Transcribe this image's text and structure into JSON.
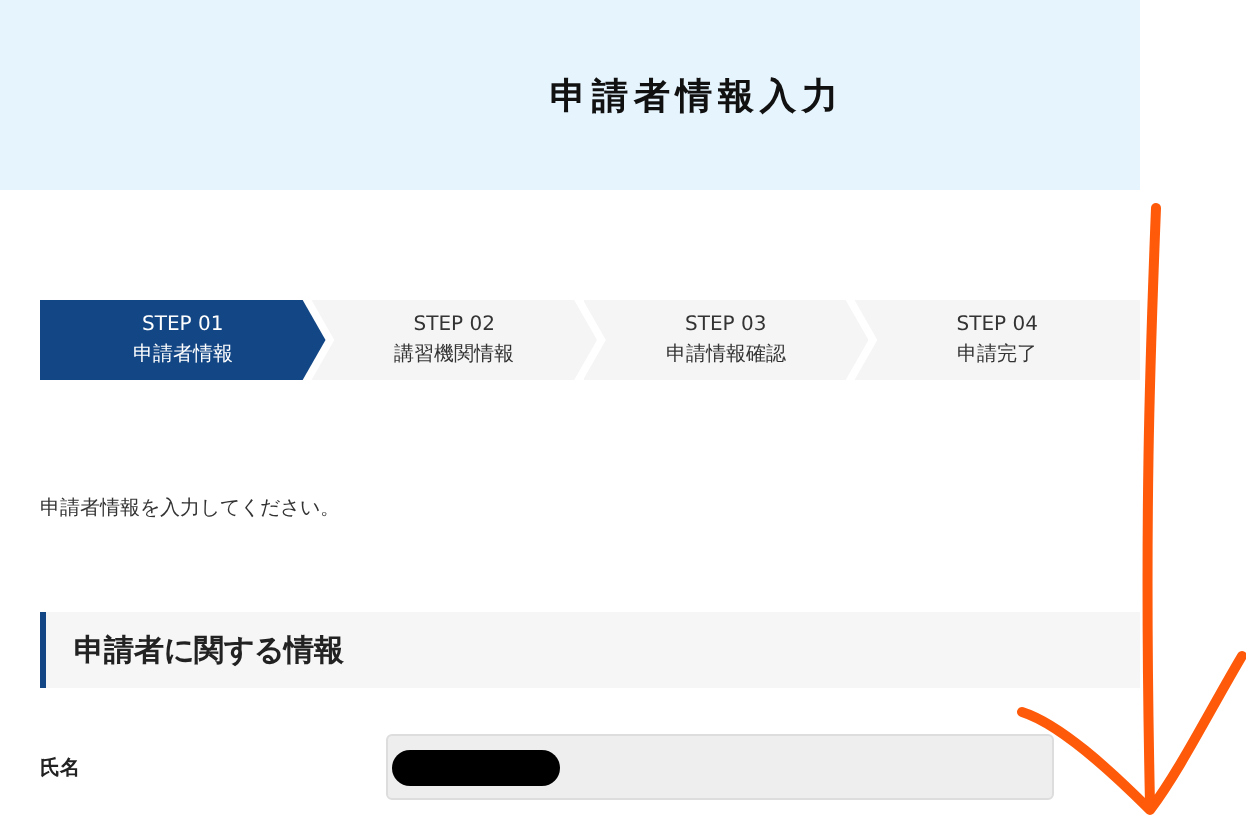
{
  "header": {
    "title": "申請者情報入力"
  },
  "steps": [
    {
      "number": "STEP 01",
      "label": "申請者情報",
      "selected": true
    },
    {
      "number": "STEP 02",
      "label": "講習機関情報",
      "selected": false
    },
    {
      "number": "STEP 03",
      "label": "申請情報確認",
      "selected": false
    },
    {
      "number": "STEP 04",
      "label": "申請完了",
      "selected": false
    }
  ],
  "intro": "申請者情報を入力してください。",
  "section": {
    "heading": "申請者に関する情報"
  },
  "fields": [
    {
      "label": "氏名",
      "redacted": true
    }
  ]
}
